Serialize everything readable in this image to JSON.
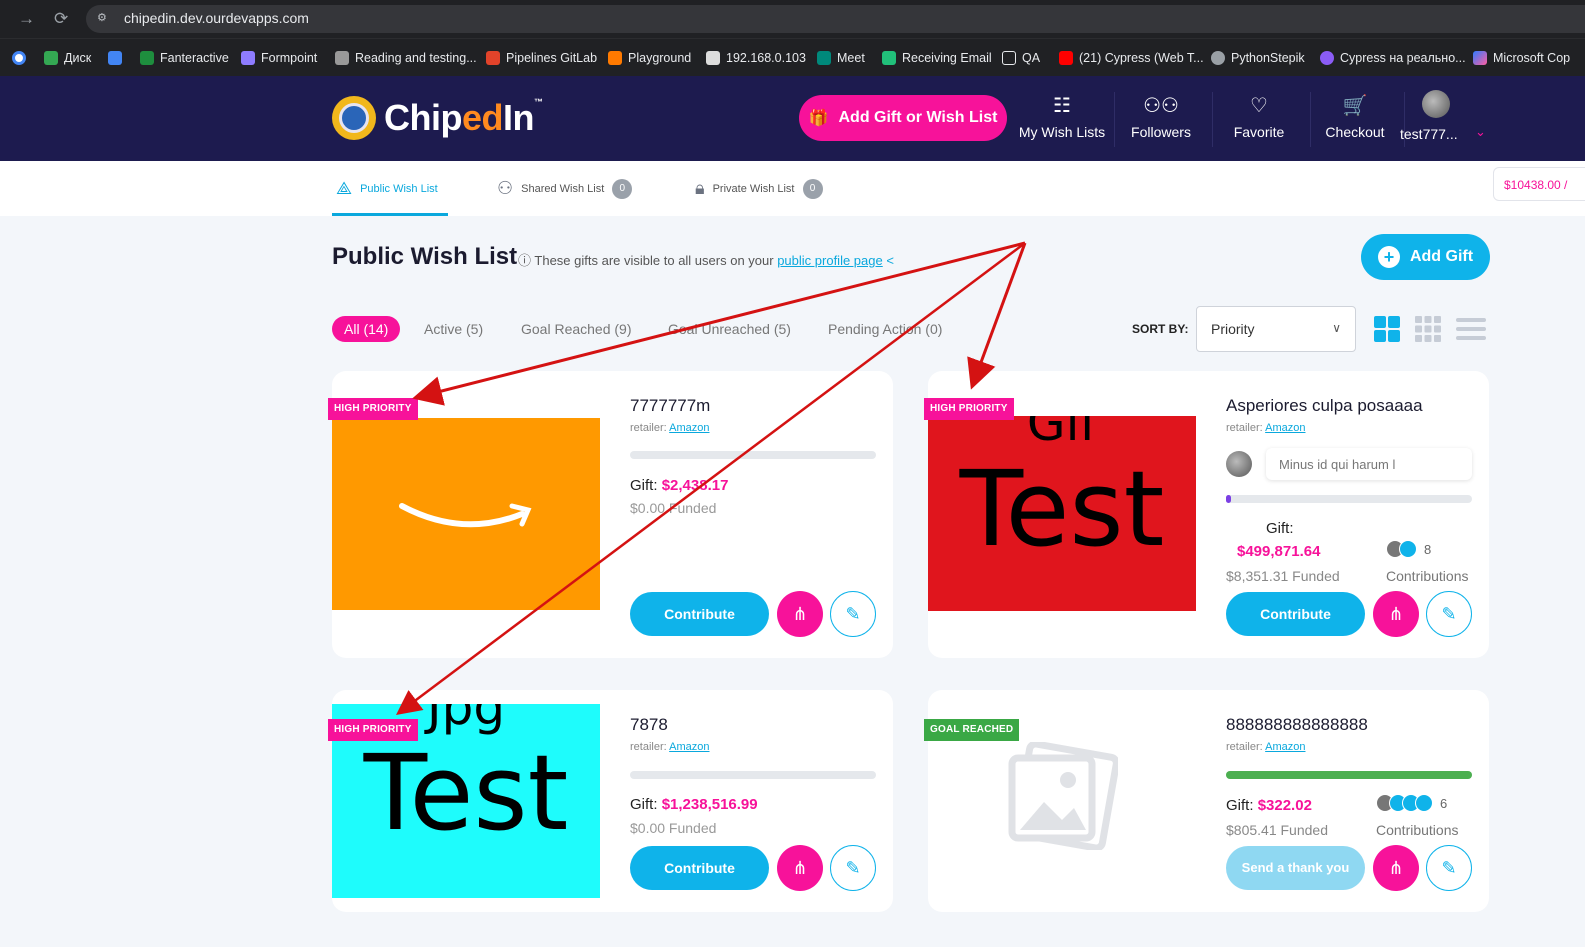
{
  "browser": {
    "url": "chipedin.dev.ourdevapps.com",
    "bookmarks": [
      "Диск",
      "Fanteractive",
      "Formpoint",
      "Reading and testing...",
      "Pipelines GitLab",
      "Playground",
      "192.168.0.103",
      "Meet",
      "Receiving Email",
      "QA",
      "(21) Cypress (Web T...",
      "PythonStepik",
      "Cypress на реально...",
      "Microsoft Cop"
    ]
  },
  "header": {
    "logo_pre": "Chip",
    "logo_mid": "ed",
    "logo_post": "In",
    "logo_tm": "™",
    "add_button": "Add Gift or Wish List",
    "nav": [
      "My Wish Lists",
      "Followers",
      "Favorite",
      "Checkout",
      "test777..."
    ]
  },
  "tabs": {
    "public": "Public Wish List",
    "shared": "Shared Wish List",
    "shared_count": "0",
    "private": "Private Wish List",
    "private_count": "0",
    "balance": "$10438.00 /"
  },
  "page": {
    "title": "Public Wish List",
    "info": "These gifts are visible to all users on your",
    "info_link": "public profile page",
    "add_gift": "Add Gift"
  },
  "filters": [
    "All (14)",
    "Active (5)",
    "Goal Reached (9)",
    "Goal Unreached (5)",
    "Pending Action (0)"
  ],
  "sort": {
    "label": "SORT BY:",
    "value": "Priority"
  },
  "cards": [
    {
      "badge": "HIGH PRIORITY",
      "title": "7777777m",
      "retailer_label": "retailer:",
      "retailer": "Amazon",
      "gift_label": "Gift:",
      "amount": "$2,438.17",
      "funded": "$0.00 Funded",
      "button": "Contribute",
      "progress": 0
    },
    {
      "badge": "HIGH PRIORITY",
      "title": "Asperiores culpa posaaaa",
      "retailer_label": "retailer:",
      "retailer": "Amazon",
      "comment": "Minus id qui harum l",
      "gift_label": "Gift:",
      "amount": "$499,871.64",
      "funded": "$8,351.31 Funded",
      "contributions_count": "8",
      "contributions_label": "Contributions",
      "button": "Contribute",
      "image_top": "Gif",
      "image_text": "Test",
      "progress": 0.02
    },
    {
      "badge": "HIGH PRIORITY",
      "title": "7878",
      "retailer_label": "retailer:",
      "retailer": "Amazon",
      "gift_label": "Gift:",
      "amount": "$1,238,516.99",
      "funded": "$0.00 Funded",
      "button": "Contribute",
      "image_top": "Jpg",
      "image_text": "Test",
      "progress": 0
    },
    {
      "badge": "GOAL REACHED",
      "title": "888888888888888",
      "retailer_label": "retailer:",
      "retailer": "Amazon",
      "gift_label": "Gift:",
      "amount": "$322.02",
      "funded": "$805.41 Funded",
      "contributions_count": "6",
      "contributions_label": "Contributions",
      "button": "Send a thank you",
      "progress": 1
    }
  ],
  "colors": {
    "brand_pink": "#f7129a",
    "brand_blue": "#0fb3ea",
    "header_bg": "#1d1b4f",
    "goal_green": "#4caf50",
    "arrow_red": "#d41212"
  }
}
